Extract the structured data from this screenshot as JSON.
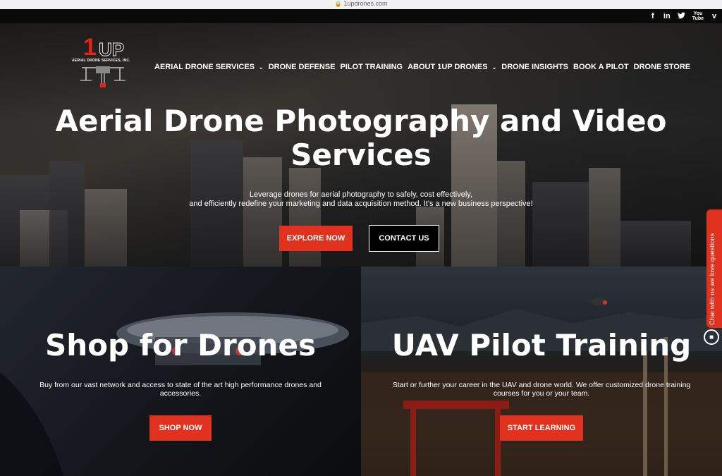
{
  "browser": {
    "url": "1updrones.com"
  },
  "social": {
    "icons": [
      "facebook-icon",
      "linkedin-icon",
      "twitter-icon",
      "youtube-icon",
      "vimeo-icon"
    ],
    "facebook": "f",
    "linkedin": "in",
    "twitter": "🐦",
    "youtube_top": "You",
    "youtube_bottom": "Tube",
    "vimeo": "v"
  },
  "logo": {
    "one": "1",
    "up": "UP",
    "subtitle": "AERIAL DRONE SERVICES, INC."
  },
  "nav": {
    "items": [
      {
        "label": "AERIAL DRONE SERVICES",
        "dropdown": true
      },
      {
        "label": "DRONE DEFENSE"
      },
      {
        "label": "PILOT TRAINING"
      },
      {
        "label": "ABOUT 1UP DRONES",
        "dropdown": true
      },
      {
        "label": "DRONE INSIGHTS"
      },
      {
        "label": "BOOK A PILOT"
      },
      {
        "label": "DRONE STORE"
      }
    ],
    "chevron": "⌄"
  },
  "hero": {
    "title_line1": "Aerial Drone Photography and Video",
    "title_line2": "Services",
    "subtitle_line1": "Leverage drones for aerial photography to safely, cost effectively,",
    "subtitle_line2": "and efficiently redefine your marketing and data acquisition method. It's a new business perspective!",
    "explore_label": "EXPLORE NOW",
    "contact_label": "CONTACT US"
  },
  "panels": {
    "shop": {
      "title": "Shop for Drones",
      "desc_line1": "Buy from our vast network and access to state of the art high performance drones and",
      "desc_line2": "accessories.",
      "button": "SHOP NOW"
    },
    "training": {
      "title": "UAV Pilot Training",
      "desc_line1": "Start or further your career in the UAV and drone world. We offer customized drone training",
      "desc_line2": "courses for you or your team.",
      "button": "START LEARNING"
    }
  },
  "chat": {
    "tab_text": "Chat with us we love questions",
    "icon": "chat-bubble-icon"
  },
  "colors": {
    "accent": "#e0321f",
    "logo_red": "#e0261c"
  }
}
